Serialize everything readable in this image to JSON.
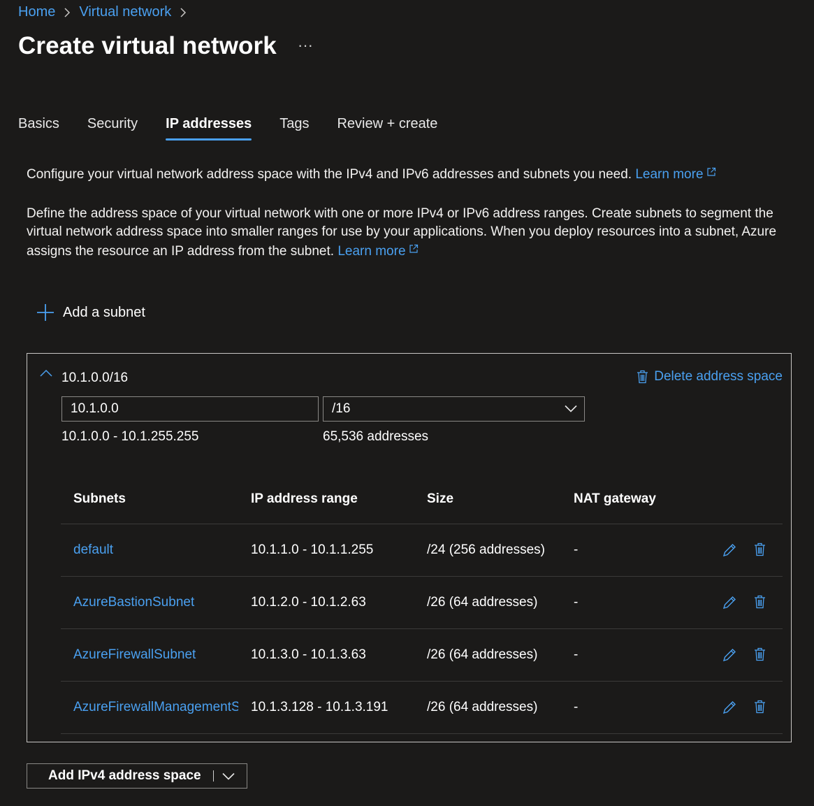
{
  "breadcrumb": {
    "home": "Home",
    "parent": "Virtual network"
  },
  "page": {
    "title": "Create virtual network",
    "more": "···"
  },
  "tabs": [
    {
      "label": "Basics",
      "active": false
    },
    {
      "label": "Security",
      "active": false
    },
    {
      "label": "IP addresses",
      "active": true
    },
    {
      "label": "Tags",
      "active": false
    },
    {
      "label": "Review + create",
      "active": false
    }
  ],
  "intro": {
    "text": "Configure your virtual network address space with the IPv4 and IPv6 addresses and subnets you need.",
    "learn_more": "Learn more"
  },
  "details": {
    "text": "Define the address space of your virtual network with one or more IPv4 or IPv6 address ranges. Create subnets to segment the virtual network address space into smaller ranges for use by your applications. When you deploy resources into a subnet, Azure assigns the resource an IP address from the subnet.",
    "learn_more": "Learn more"
  },
  "add_subnet_label": "Add a subnet",
  "address_space": {
    "label": "10.1.0.0/16",
    "delete_label": "Delete address space",
    "address_value": "10.1.0.0",
    "prefix_value": "/16",
    "range": "10.1.0.0 - 10.1.255.255",
    "count": "65,536 addresses"
  },
  "subnets_table": {
    "headers": [
      "Subnets",
      "IP address range",
      "Size",
      "NAT gateway"
    ],
    "rows": [
      {
        "name": "default",
        "range": "10.1.1.0 - 10.1.1.255",
        "size": "/24 (256 addresses)",
        "nat": "-"
      },
      {
        "name": "AzureBastionSubnet",
        "range": "10.1.2.0 - 10.1.2.63",
        "size": "/26 (64 addresses)",
        "nat": "-"
      },
      {
        "name": "AzureFirewallSubnet",
        "range": "10.1.3.0 - 10.1.3.63",
        "size": "/26 (64 addresses)",
        "nat": "-"
      },
      {
        "name": "AzureFirewallManagementS",
        "range": "10.1.3.128 - 10.1.3.191",
        "size": "/26 (64 addresses)",
        "nat": "-"
      }
    ]
  },
  "add_space_button": "Add IPv4 address space",
  "colors": {
    "background": "#1b1a19",
    "link": "#4aa0f0",
    "border": "#c8c6c4",
    "divider": "#3b3a39"
  },
  "icons": [
    "chevron-right-icon",
    "external-link-icon",
    "plus-icon",
    "chevron-up-icon",
    "trash-icon",
    "chevron-down-icon",
    "pencil-icon"
  ]
}
